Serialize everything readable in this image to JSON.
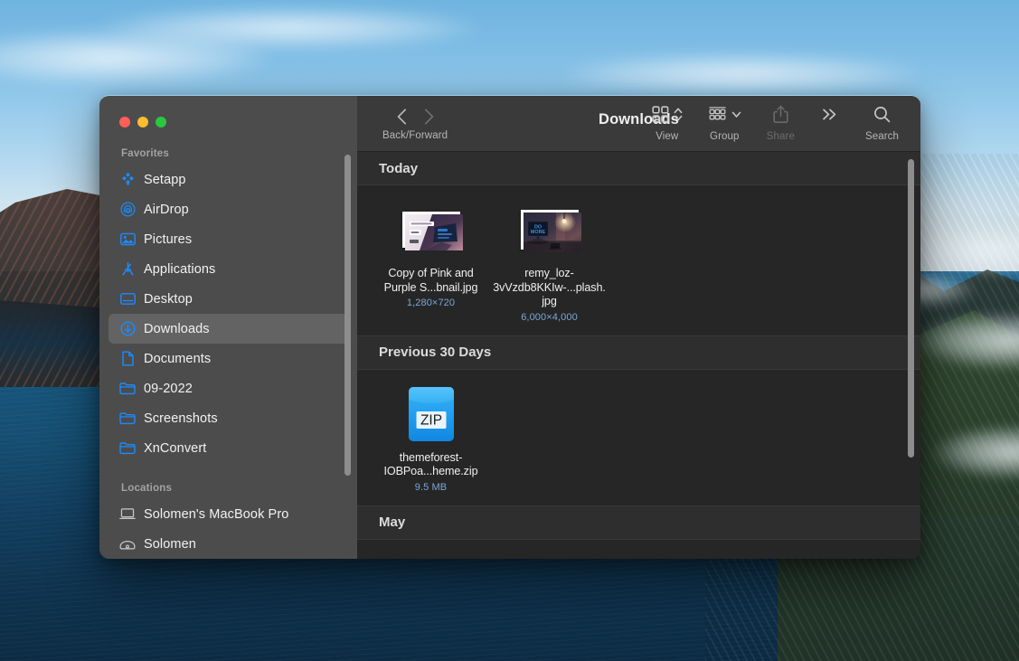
{
  "window": {
    "title": "Downloads",
    "traffic_lights": [
      {
        "name": "close",
        "color": "#ff5f57"
      },
      {
        "name": "minimize",
        "color": "#febc2e"
      },
      {
        "name": "zoom",
        "color": "#28c840"
      }
    ]
  },
  "toolbar": {
    "nav_caption": "Back/Forward",
    "back_icon": "chevron-left-icon",
    "forward_icon": "chevron-right-icon",
    "buttons": [
      {
        "id": "view",
        "label": "View",
        "icon": "grid-view-icon",
        "adornment": "chevron-updown-icon",
        "disabled": false
      },
      {
        "id": "group",
        "label": "Group",
        "icon": "group-by-icon",
        "adornment": "chevron-down-icon",
        "disabled": false
      },
      {
        "id": "share",
        "label": "Share",
        "icon": "share-icon",
        "adornment": "",
        "disabled": true
      },
      {
        "id": "more",
        "label": "",
        "icon": "chevrons-right-icon",
        "adornment": "",
        "disabled": false
      },
      {
        "id": "search",
        "label": "Search",
        "icon": "search-icon",
        "adornment": "",
        "disabled": false
      }
    ]
  },
  "sidebar": {
    "groups": [
      {
        "title": "Favorites",
        "items": [
          {
            "label": "Setapp",
            "icon": "setapp-icon",
            "active": false
          },
          {
            "label": "AirDrop",
            "icon": "airdrop-icon",
            "active": false
          },
          {
            "label": "Pictures",
            "icon": "pictures-icon",
            "active": false
          },
          {
            "label": "Applications",
            "icon": "applications-icon",
            "active": false
          },
          {
            "label": "Desktop",
            "icon": "desktop-icon",
            "active": false
          },
          {
            "label": "Downloads",
            "icon": "downloads-icon",
            "active": true
          },
          {
            "label": "Documents",
            "icon": "document-icon",
            "active": false
          },
          {
            "label": "09-2022",
            "icon": "folder-icon",
            "active": false
          },
          {
            "label": "Screenshots",
            "icon": "folder-icon",
            "active": false
          },
          {
            "label": "XnConvert",
            "icon": "folder-icon",
            "active": false
          }
        ]
      },
      {
        "title": "Locations",
        "items": [
          {
            "label": "Solomen's MacBook Pro",
            "icon": "laptop-icon",
            "active": false
          },
          {
            "label": "Solomen",
            "icon": "disk-icon",
            "active": false
          }
        ]
      }
    ]
  },
  "content": {
    "sections": [
      {
        "header": "Today",
        "files": [
          {
            "name": "Copy of Pink and Purple S...bnail.jpg",
            "meta": "1,280×720",
            "kind": "image-thumbnail",
            "thumb": "pink-purple-laptop-thumbnail"
          },
          {
            "name": "remy_loz-3vVzdb8KKIw-...plash.jpg",
            "meta": "6,000×4,000",
            "kind": "image-thumbnail",
            "thumb": "dark-monitor-desk-photo"
          }
        ]
      },
      {
        "header": "Previous 30 Days",
        "files": [
          {
            "name": "themeforest-IOBPoa...heme.zip",
            "meta": "9.5 MB",
            "kind": "zip-archive",
            "thumb": "zip-icon",
            "badge": "ZIP"
          }
        ]
      },
      {
        "header": "May",
        "files": []
      }
    ]
  },
  "colors": {
    "sidebar_bg": "#4c4c4c",
    "toolbar_bg": "#3a3a3a",
    "content_bg": "#262626",
    "section_header_bg": "#2e2e2e",
    "accent_blue": "#0a84ff",
    "meta_blue": "#7aa7d8"
  }
}
